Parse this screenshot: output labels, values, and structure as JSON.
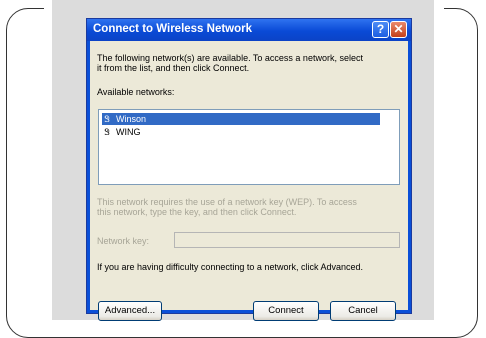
{
  "dialog": {
    "title": "Connect to Wireless Network",
    "help_icon": "?",
    "close_icon": "✕",
    "intro_line1": "The following network(s) are available. To access a network, select",
    "intro_line2": "it from the list, and then click Connect.",
    "available_label": "Available networks:",
    "networks": [
      {
        "name": "Winson",
        "selected": true,
        "icon": "antenna-icon"
      },
      {
        "name": "WING",
        "selected": false,
        "icon": "antenna-icon"
      }
    ],
    "network_icon_glyph": "Ꮥ",
    "wep_line1": "This network requires the use of a network key (WEP). To access",
    "wep_line2": "this network, type the key, and then click Connect.",
    "network_key_label": "Network key:",
    "network_key_value": "",
    "advanced_hint": "If you are having difficulty connecting to a network, click Advanced.",
    "buttons": {
      "advanced": "Advanced...",
      "connect": "Connect",
      "cancel": "Cancel"
    }
  },
  "colors": {
    "titlebar": "#0a4ad6",
    "client_bg": "#ece9d8",
    "selection": "#316ac5",
    "panel_bg": "#dcdcdc"
  }
}
